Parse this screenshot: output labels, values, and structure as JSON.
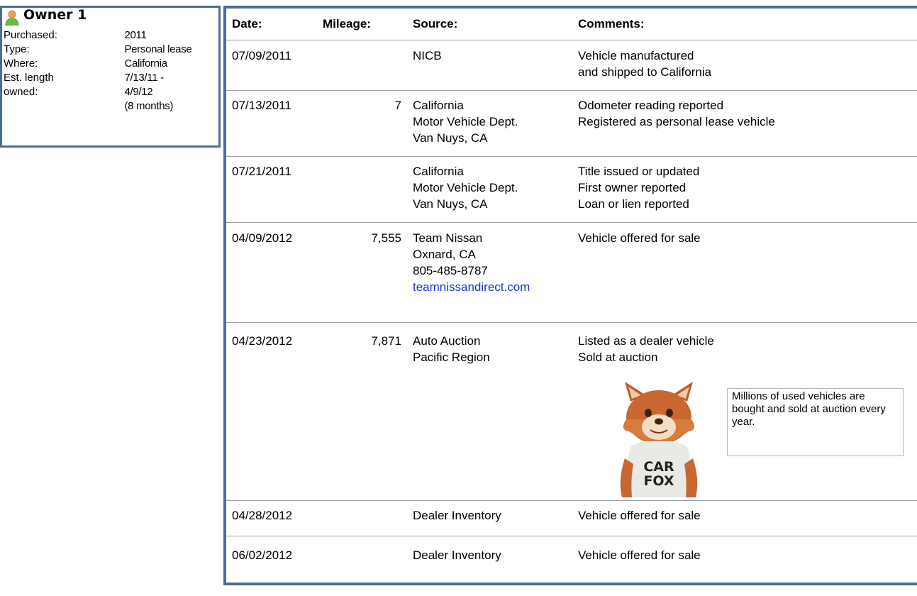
{
  "owner": {
    "title": "Owner 1",
    "rows": [
      {
        "label": "Purchased:",
        "value": [
          "2011"
        ]
      },
      {
        "label": "Type:",
        "value": [
          "Personal lease"
        ]
      },
      {
        "label": "Where:",
        "value": [
          "California"
        ]
      },
      {
        "label": "Est. length",
        "label2": "owned:",
        "value": [
          "7/13/11 -",
          "4/9/12",
          "(8 months)"
        ]
      }
    ]
  },
  "table": {
    "headers": {
      "date": "Date:",
      "mileage": "Mileage:",
      "source": "Source:",
      "comments": "Comments:"
    },
    "records": [
      {
        "date": "07/09/2011",
        "mileage": "",
        "source": [
          "NICB"
        ],
        "comments": [
          "Vehicle manufactured",
          "and shipped to California"
        ]
      },
      {
        "date": "07/13/2011",
        "mileage": "7",
        "source": [
          "California",
          "Motor Vehicle Dept.",
          "Van Nuys, CA"
        ],
        "comments": [
          "Odometer reading reported",
          "Registered as personal lease vehicle"
        ]
      },
      {
        "date": "07/21/2011",
        "mileage": "",
        "source": [
          "California",
          "Motor Vehicle Dept.",
          "Van Nuys, CA"
        ],
        "comments": [
          "Title issued or updated",
          "First owner reported",
          "Loan or lien reported"
        ]
      },
      {
        "date": "04/09/2012",
        "mileage": "7,555",
        "source": [
          "Team Nissan",
          "Oxnard, CA",
          "805-485-8787"
        ],
        "source_link": "teamnissandirect.com",
        "comments": [
          "Vehicle offered for sale"
        ]
      },
      {
        "date": "04/23/2012",
        "mileage": "7,871",
        "source": [
          "Auto Auction",
          "Pacific Region"
        ],
        "comments": [
          "Listed as a dealer vehicle",
          "Sold at auction"
        ]
      },
      {
        "date": "04/28/2012",
        "mileage": "",
        "source": [
          "Dealer Inventory"
        ],
        "comments": [
          "Vehicle offered for sale"
        ]
      },
      {
        "date": "06/02/2012",
        "mileage": "",
        "source": [
          "Dealer Inventory"
        ],
        "comments": [
          "Vehicle offered for sale"
        ]
      }
    ]
  },
  "fox": {
    "shirt_line1": "CAR",
    "shirt_line2": "FOX",
    "tip": "Millions of used vehicles are bought and sold at auction every year."
  }
}
